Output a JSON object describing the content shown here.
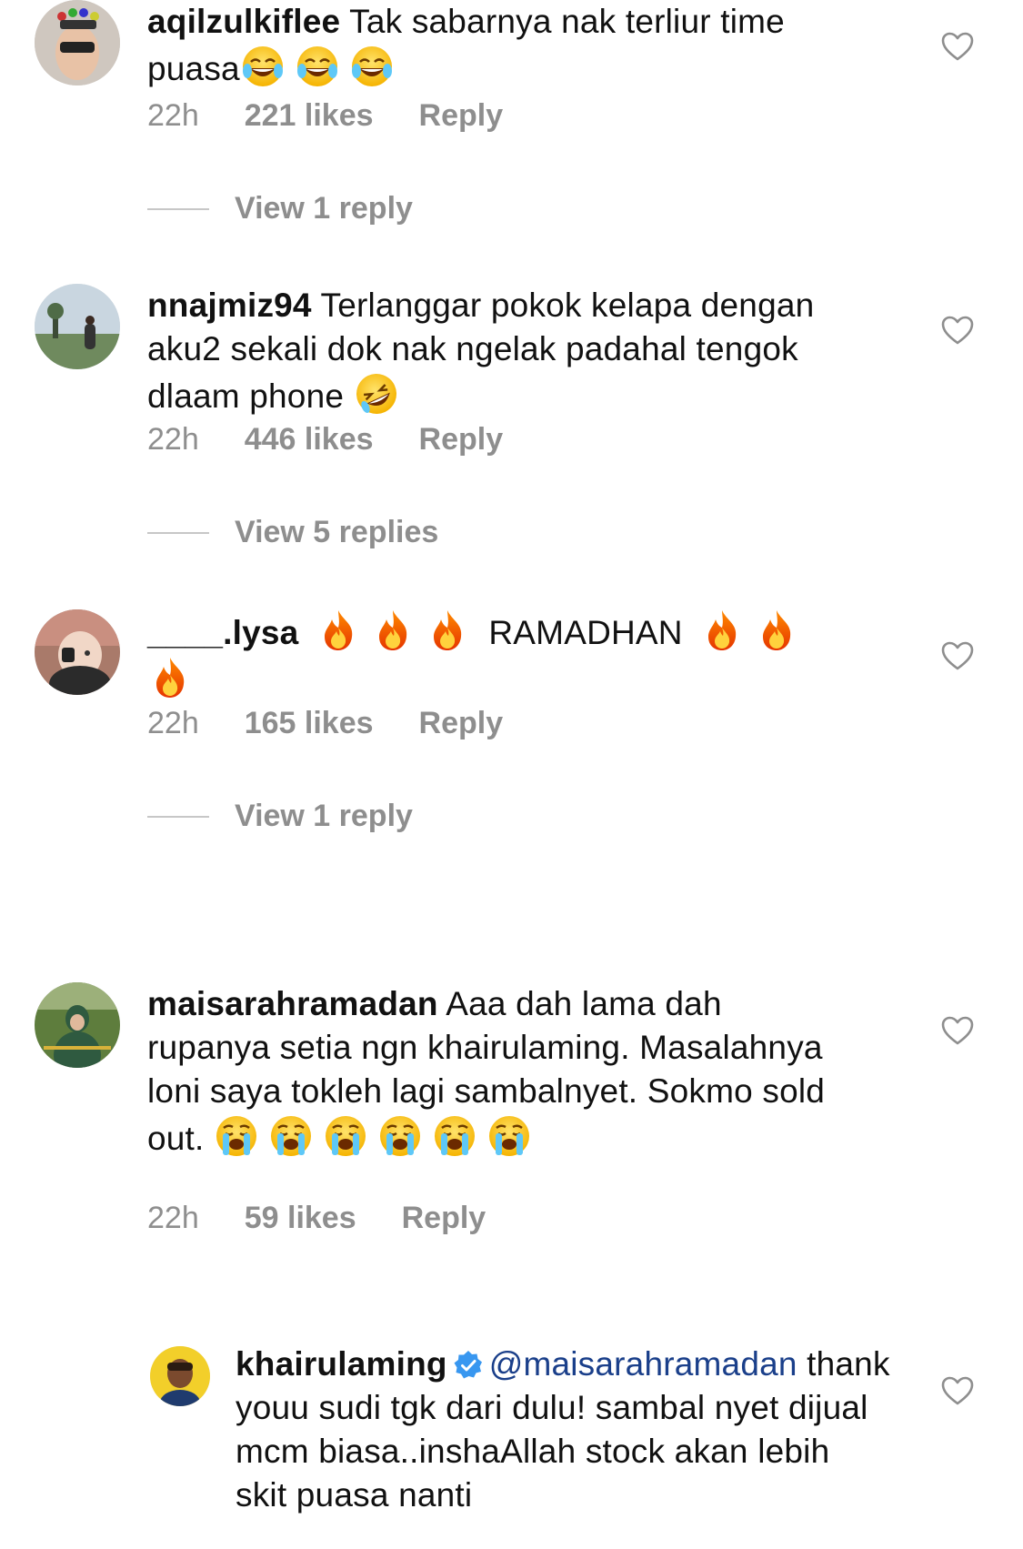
{
  "comments": [
    {
      "username": "aqilzulkiflee",
      "text": "Tak sabarnya nak terliur time puasa",
      "time": "22h",
      "likes": "221 likes",
      "reply_label": "Reply",
      "view_replies": "View 1 reply",
      "emoji": "laughing-tears"
    },
    {
      "username": "nnajmiz94",
      "text": "Terlanggar pokok kelapa dengan aku2 sekali dok nak ngelak padahal tengok dlaam phone",
      "time": "22h",
      "likes": "446 likes",
      "reply_label": "Reply",
      "view_replies": "View 5 replies",
      "emoji": "rolling-laughing"
    },
    {
      "username": "____.lysa",
      "text": "RAMADHAN",
      "time": "22h",
      "likes": "165 likes",
      "reply_label": "Reply",
      "view_replies": "View 1 reply",
      "emoji": "fire"
    },
    {
      "username": "maisarahramadan",
      "text": "Aaa dah lama dah rupanya setia ngn khairulaming. Masalahnya loni saya tokleh lagi sambalnyet. Sokmo sold out.",
      "time": "22h",
      "likes": "59 likes",
      "reply_label": "Reply",
      "emoji": "loudly-crying"
    }
  ],
  "reply": {
    "username": "khairulaming",
    "mention": "@maisarahramadan",
    "text": "thank youu sudi tgk dari dulu! sambal nyet dijual mcm biasa..inshaAllah stock akan lebih skit puasa nanti",
    "verified": true
  },
  "colors": {
    "meta_grey": "#8e8e8e",
    "mention_blue": "#1a3f8a",
    "verified_blue": "#3897f0"
  }
}
